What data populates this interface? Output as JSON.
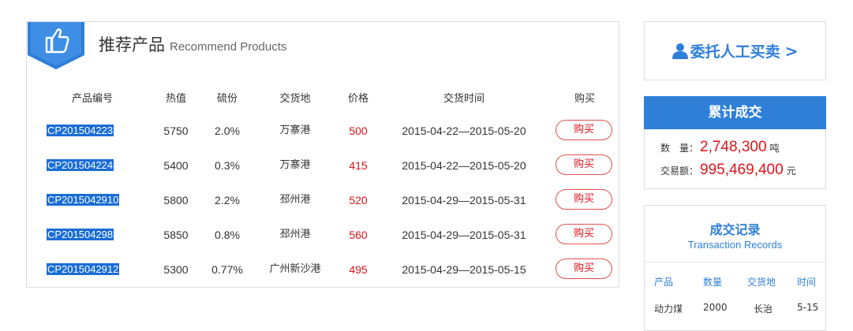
{
  "recommend": {
    "title_cn": "推荐产品",
    "title_en": "Recommend Products",
    "columns": [
      "产品编号",
      "热值",
      "硫份",
      "交货地",
      "价格",
      "交货时间",
      "购买"
    ],
    "rows": [
      {
        "code": "CP201504223",
        "heat": "5750",
        "sulfur": "2.0%",
        "place": "万寨港",
        "price": "500",
        "date": "2015-04-22—2015-05-20",
        "buy": "购买"
      },
      {
        "code": "CP201504224",
        "heat": "5400",
        "sulfur": "0.3%",
        "place": "万寨港",
        "price": "415",
        "date": "2015-04-22—2015-05-20",
        "buy": "购买"
      },
      {
        "code": "CP2015042910",
        "heat": "5800",
        "sulfur": "2.2%",
        "place": "邳州港",
        "price": "520",
        "date": "2015-04-29—2015-05-31",
        "buy": "购买"
      },
      {
        "code": "CP201504298",
        "heat": "5850",
        "sulfur": "0.8%",
        "place": "邳州港",
        "price": "560",
        "date": "2015-04-29—2015-05-31",
        "buy": "购买"
      },
      {
        "code": "CP2015042912",
        "heat": "5300",
        "sulfur": "0.77%",
        "place": "广州新沙港",
        "price": "495",
        "date": "2015-04-29—2015-05-15",
        "buy": "购买"
      }
    ]
  },
  "entrust": {
    "label": "委托人工买卖",
    "arrow": ">"
  },
  "total": {
    "title": "累计成交",
    "qty_label": "数　量：",
    "qty_value": "2,748,300",
    "qty_unit": "吨",
    "amount_label": "交易额：",
    "amount_value": "995,469,400",
    "amount_unit": "元"
  },
  "records": {
    "title_cn": "成交记录",
    "title_en": "Transaction Records",
    "columns": [
      "产品",
      "数量",
      "交货地",
      "时间"
    ],
    "rows": [
      {
        "product": "动力煤",
        "qty": "2000",
        "place": "长治",
        "time": "5-15"
      }
    ]
  },
  "colors": {
    "accent": "#2f7fd8",
    "price": "#e0121b",
    "selection": "#1a6dd6"
  }
}
